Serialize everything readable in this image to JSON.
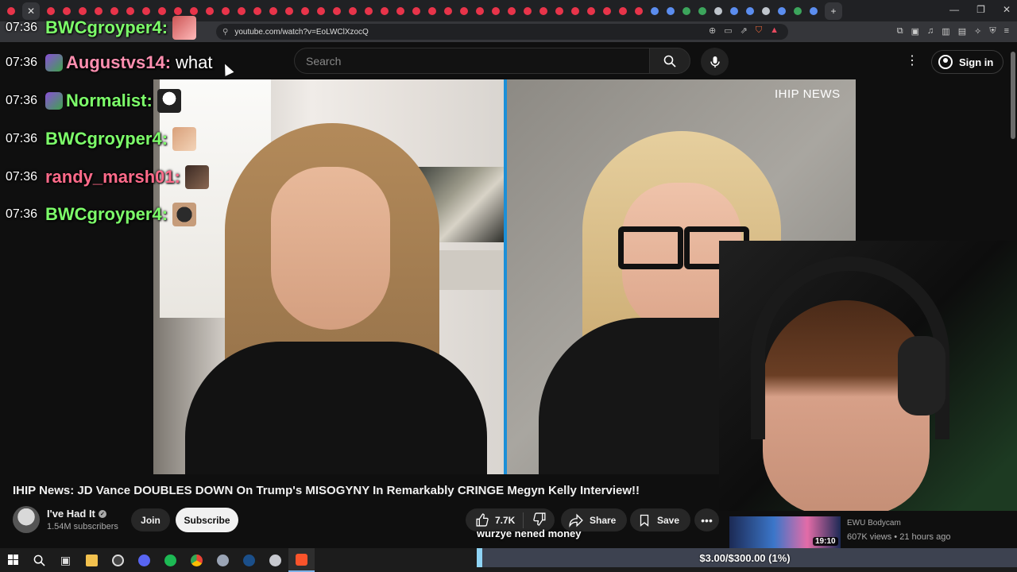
{
  "browser": {
    "url": "youtube.com/watch?v=EoLWClXzocQ"
  },
  "youtube": {
    "search_placeholder": "Search",
    "sign_in_label": "Sign in"
  },
  "video": {
    "watermark": "IHIP NEWS",
    "title": "IHIP News: JD Vance DOUBLES DOWN On Trump's MISOGYNY In Remarkably CRINGE Megyn Kelly Interview!!"
  },
  "channel": {
    "name": "I've Had It",
    "subscribers": "1.54M subscribers",
    "join_label": "Join",
    "subscribe_label": "Subscribe"
  },
  "actions": {
    "like_count": "7.7K",
    "share_label": "Share",
    "save_label": "Save"
  },
  "chat": {
    "messages": [
      {
        "time": "07:36",
        "user": "BWCgroyper4",
        "message": "",
        "color": "#7dff6a"
      },
      {
        "time": "07:36",
        "user": "Augustvs14",
        "message": "what",
        "color": "#ff8fb0"
      },
      {
        "time": "07:36",
        "user": "Normalist",
        "message": "",
        "color": "#7dff6a"
      },
      {
        "time": "07:36",
        "user": "BWCgroyper4",
        "message": "",
        "color": "#7dff6a"
      },
      {
        "time": "07:36",
        "user": "randy_marsh01",
        "message": "",
        "color": "#ff6b8a"
      },
      {
        "time": "07:36",
        "user": "BWCgroyper4",
        "message": "",
        "color": "#7dff6a"
      }
    ]
  },
  "donation": {
    "message": "wurzye nened money",
    "goal_text": "$3.00/$300.00 (1%)",
    "goal_fraction": 0.01
  },
  "recommended": {
    "title": "EWU Bodycam",
    "meta": "607K views • 21 hours ago",
    "duration": "19:10"
  },
  "colors": {
    "accent_divider": "#1b8fd8",
    "goal_fill": "#8fd4f5"
  }
}
